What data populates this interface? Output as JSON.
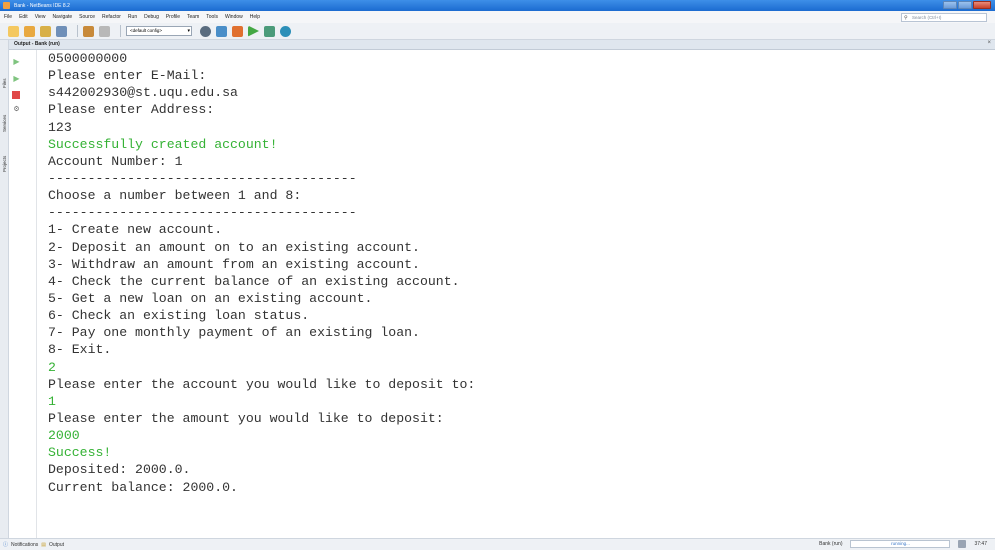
{
  "window": {
    "title": "Bank - NetBeans IDE 8.2"
  },
  "menu": [
    "File",
    "Edit",
    "View",
    "Navigate",
    "Source",
    "Refactor",
    "Run",
    "Debug",
    "Profile",
    "Team",
    "Tools",
    "Window",
    "Help"
  ],
  "search": {
    "placeholder": "Search (Ctrl+I)"
  },
  "toolbar": {
    "config_value": "<default config>"
  },
  "sidebar": {
    "tabs": [
      "Files",
      "Services",
      "Projects"
    ]
  },
  "output": {
    "title": "Output - Bank (run)",
    "lines": [
      {
        "text": "0500000000",
        "kind": "normal"
      },
      {
        "text": "Please enter E-Mail:",
        "kind": "normal"
      },
      {
        "text": "s442002930@st.uqu.edu.sa",
        "kind": "normal"
      },
      {
        "text": "Please enter Address:",
        "kind": "normal"
      },
      {
        "text": "123",
        "kind": "normal"
      },
      {
        "text": "Successfully created account!",
        "kind": "success"
      },
      {
        "text": "Account Number: 1",
        "kind": "normal"
      },
      {
        "text": "---------------------------------------",
        "kind": "normal"
      },
      {
        "text": "Choose a number between 1 and 8:",
        "kind": "normal"
      },
      {
        "text": "---------------------------------------",
        "kind": "normal"
      },
      {
        "text": "1- Create new account.",
        "kind": "normal"
      },
      {
        "text": "2- Deposit an amount on to an existing account.",
        "kind": "normal"
      },
      {
        "text": "3- Withdraw an amount from an existing account.",
        "kind": "normal"
      },
      {
        "text": "4- Check the current balance of an existing account.",
        "kind": "normal"
      },
      {
        "text": "5- Get a new loan on an existing account.",
        "kind": "normal"
      },
      {
        "text": "6- Check an existing loan status.",
        "kind": "normal"
      },
      {
        "text": "7- Pay one monthly payment of an existing loan.",
        "kind": "normal"
      },
      {
        "text": "8- Exit.",
        "kind": "normal"
      },
      {
        "text": "2",
        "kind": "input"
      },
      {
        "text": "Please enter the account you would like to deposit to:",
        "kind": "normal"
      },
      {
        "text": "1",
        "kind": "input"
      },
      {
        "text": "Please enter the amount you would like to deposit:",
        "kind": "normal"
      },
      {
        "text": "2000",
        "kind": "input"
      },
      {
        "text": "Success!",
        "kind": "success"
      },
      {
        "text": "Deposited: 2000.0.",
        "kind": "normal"
      },
      {
        "text": "Current balance: 2000.0.",
        "kind": "normal"
      }
    ]
  },
  "status": {
    "notifications_label": "Notifications",
    "output_label": "Output",
    "task_label": "Bank (run)",
    "progress_label": "running...",
    "position": "37:47"
  },
  "colors": {
    "success_text": "#35b235",
    "console_text": "#333333",
    "titlebar": "#1b6bd0"
  }
}
